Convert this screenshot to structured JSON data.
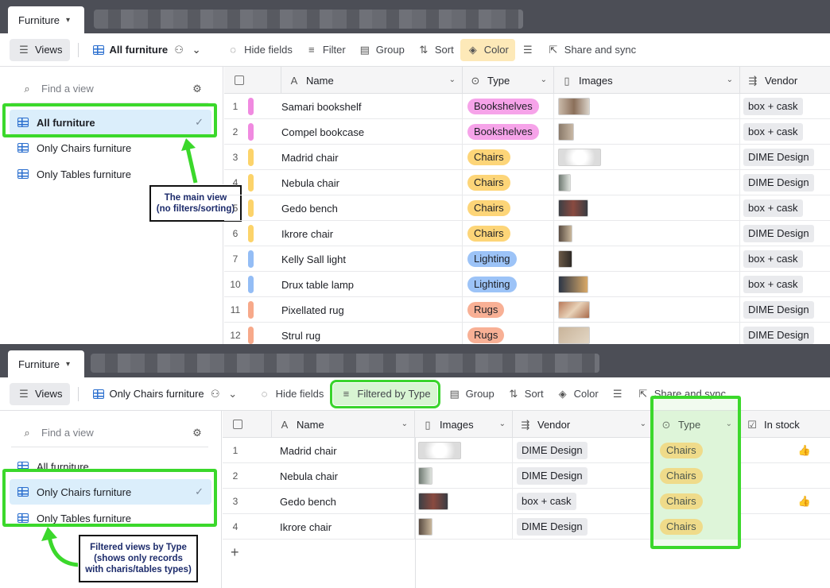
{
  "top": {
    "tab_label": "Furniture",
    "toolbar": {
      "views_label": "Views",
      "current_view": "All furniture",
      "hide_fields": "Hide fields",
      "filter": "Filter",
      "group": "Group",
      "sort": "Sort",
      "color": "Color",
      "share": "Share and sync"
    },
    "sidebar": {
      "search_placeholder": "Find a view",
      "views": [
        {
          "label": "All furniture",
          "active": true
        },
        {
          "label": "Only Chairs furniture",
          "active": false
        },
        {
          "label": "Only Tables furniture",
          "active": false
        }
      ]
    },
    "callout": "The main view\n(no filters/sorting)",
    "columns": [
      "Name",
      "Type",
      "Images",
      "Vendor"
    ],
    "rows": [
      {
        "num": "1",
        "name": "Samari bookshelf",
        "type": "Bookshelves",
        "vendor": "box + cask",
        "color": "#f08ae0",
        "pill": "#f6a3e9"
      },
      {
        "num": "2",
        "name": "Compel bookcase",
        "type": "Bookshelves",
        "vendor": "box + cask",
        "color": "#f08ae0",
        "pill": "#f6a3e9"
      },
      {
        "num": "3",
        "name": "Madrid chair",
        "type": "Chairs",
        "vendor": "DIME Design",
        "color": "#fcd36a",
        "pill": "#fdd578"
      },
      {
        "num": "4",
        "name": "Nebula chair",
        "type": "Chairs",
        "vendor": "DIME Design",
        "color": "#fcd36a",
        "pill": "#fdd578"
      },
      {
        "num": "5",
        "name": "Gedo bench",
        "type": "Chairs",
        "vendor": "box + cask",
        "color": "#fcd36a",
        "pill": "#fdd578"
      },
      {
        "num": "6",
        "name": "Ikrore chair",
        "type": "Chairs",
        "vendor": "DIME Design",
        "color": "#fcd36a",
        "pill": "#fdd578"
      },
      {
        "num": "7",
        "name": "Kelly Sall light",
        "type": "Lighting",
        "vendor": "box + cask",
        "color": "#94bdf5",
        "pill": "#9cc3f7"
      },
      {
        "num": "10",
        "name": "Drux table lamp",
        "type": "Lighting",
        "vendor": "box + cask",
        "color": "#94bdf5",
        "pill": "#9cc3f7"
      },
      {
        "num": "11",
        "name": "Pixellated rug",
        "type": "Rugs",
        "vendor": "DIME Design",
        "color": "#f7a98a",
        "pill": "#f8b095"
      },
      {
        "num": "12",
        "name": "Strul rug",
        "type": "Rugs",
        "vendor": "DIME Design",
        "color": "#f7a98a",
        "pill": "#f8b095"
      }
    ]
  },
  "bottom": {
    "tab_label": "Furniture",
    "toolbar": {
      "views_label": "Views",
      "current_view": "Only Chairs furniture",
      "hide_fields": "Hide fields",
      "filter": "Filtered by Type",
      "group": "Group",
      "sort": "Sort",
      "color": "Color",
      "share": "Share and sync"
    },
    "sidebar": {
      "search_placeholder": "Find a view",
      "views": [
        {
          "label": "All furniture",
          "active": false
        },
        {
          "label": "Only Chairs furniture",
          "active": true
        },
        {
          "label": "Only Tables furniture",
          "active": false
        }
      ]
    },
    "callout": "Filtered views by Type\n(shows only records\nwith charis/tables types)",
    "columns": [
      "Name",
      "Images",
      "Vendor",
      "Type",
      "In stock"
    ],
    "rows": [
      {
        "num": "1",
        "name": "Madrid chair",
        "vendor": "DIME Design",
        "type": "Chairs",
        "in_stock": true
      },
      {
        "num": "2",
        "name": "Nebula chair",
        "vendor": "DIME Design",
        "type": "Chairs",
        "in_stock": false
      },
      {
        "num": "3",
        "name": "Gedo bench",
        "vendor": "box + cask",
        "type": "Chairs",
        "in_stock": true
      },
      {
        "num": "4",
        "name": "Ikrore chair",
        "vendor": "DIME Design",
        "type": "Chairs",
        "in_stock": false
      }
    ],
    "add_row_label": "+"
  },
  "colors": {
    "highlight": "#3bd82b",
    "active_view_bg": "#dbeefb",
    "chairs_pill": "#fdd578",
    "type_column_bg": "#e6f7e2"
  }
}
